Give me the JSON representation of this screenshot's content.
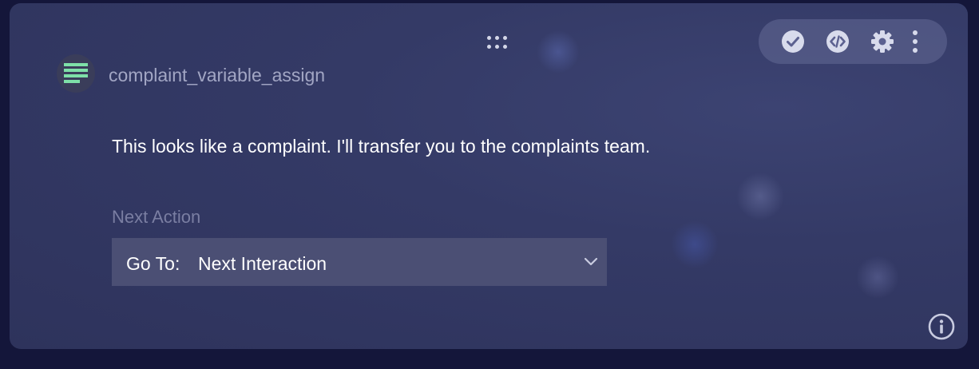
{
  "node": {
    "name": "complaint_variable_assign",
    "message": "This looks like a complaint. I'll transfer you to the complaints team."
  },
  "next_action": {
    "label": "Next Action",
    "prefix": "Go To:",
    "value": "Next Interaction"
  },
  "toolbar": {
    "icons": [
      "check-circle-icon",
      "code-icon",
      "gear-icon",
      "more-vertical-icon"
    ]
  },
  "colors": {
    "card_background": "#343a66",
    "page_background": "#14163a",
    "toolbar_background": "#5c6190",
    "select_background": "#4b4f74",
    "node_icon_accent": "#7ee0a8",
    "primary_text": "#ffffff",
    "muted_text": "#a2a6c4",
    "label_text": "#7a7ea2"
  }
}
